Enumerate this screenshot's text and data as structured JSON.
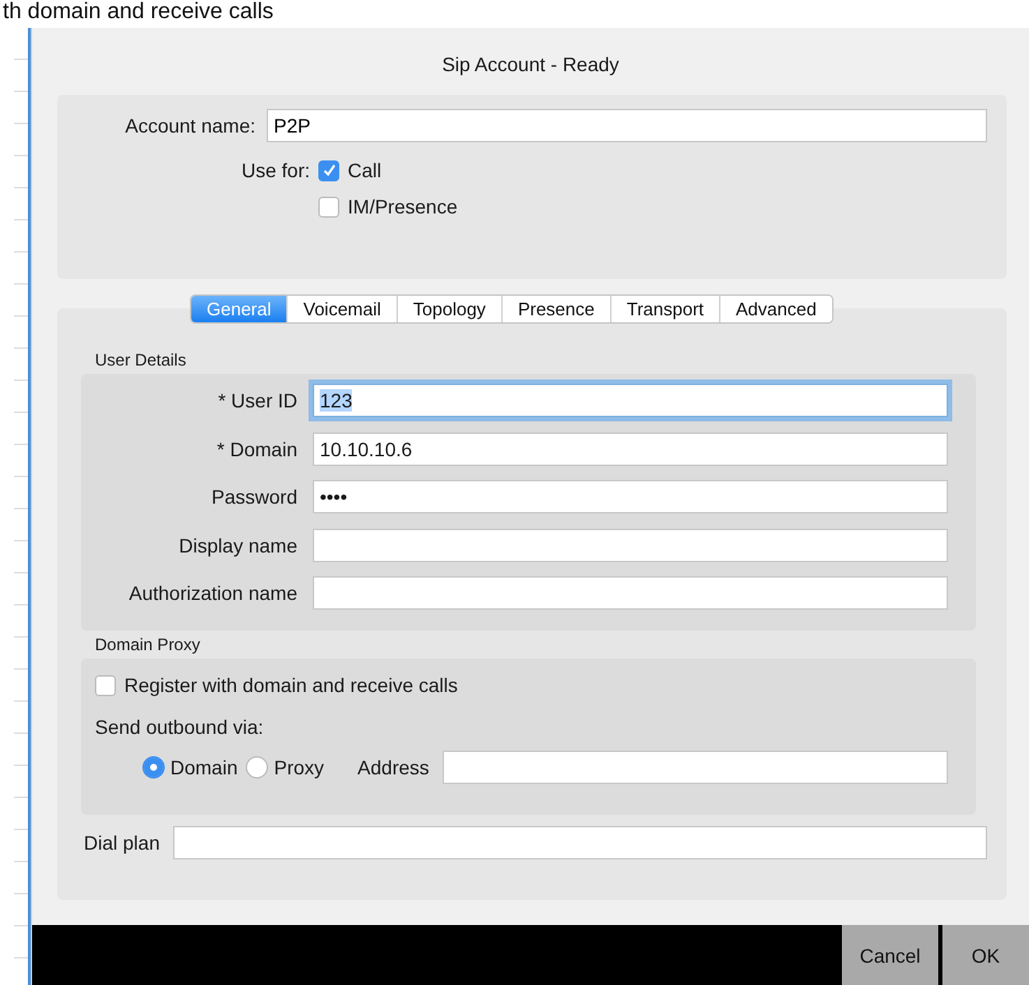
{
  "background_text": "th domain and receive calls",
  "window": {
    "title": "Sip Account - Ready"
  },
  "account": {
    "name_label": "Account name:",
    "name_value": "P2P",
    "use_for_label": "Use for:",
    "options": [
      {
        "label": "Call",
        "checked": true
      },
      {
        "label": "IM/Presence",
        "checked": false
      }
    ]
  },
  "tabs": [
    {
      "label": "General",
      "selected": true
    },
    {
      "label": "Voicemail",
      "selected": false
    },
    {
      "label": "Topology",
      "selected": false
    },
    {
      "label": "Presence",
      "selected": false
    },
    {
      "label": "Transport",
      "selected": false
    },
    {
      "label": "Advanced",
      "selected": false
    }
  ],
  "user_details": {
    "heading": "User Details",
    "fields": [
      {
        "label": "* User ID",
        "value": "123",
        "focused": true
      },
      {
        "label": "* Domain",
        "value": "10.10.10.6",
        "focused": false
      },
      {
        "label": "Password",
        "value": "••••",
        "focused": false
      },
      {
        "label": "Display name",
        "focused": false
      },
      {
        "label": "Authorization name",
        "focused": false
      }
    ]
  },
  "domain_proxy": {
    "heading": "Domain Proxy",
    "register": {
      "label": "Register with domain and receive calls",
      "checked": false
    },
    "send_label": "Send outbound via:",
    "routes": [
      {
        "label": "Domain",
        "selected": true
      },
      {
        "label": "Proxy",
        "selected": false
      }
    ],
    "address_label": "Address"
  },
  "dial_plan": {
    "label": "Dial plan"
  },
  "buttons": [
    "Cancel",
    "OK"
  ]
}
